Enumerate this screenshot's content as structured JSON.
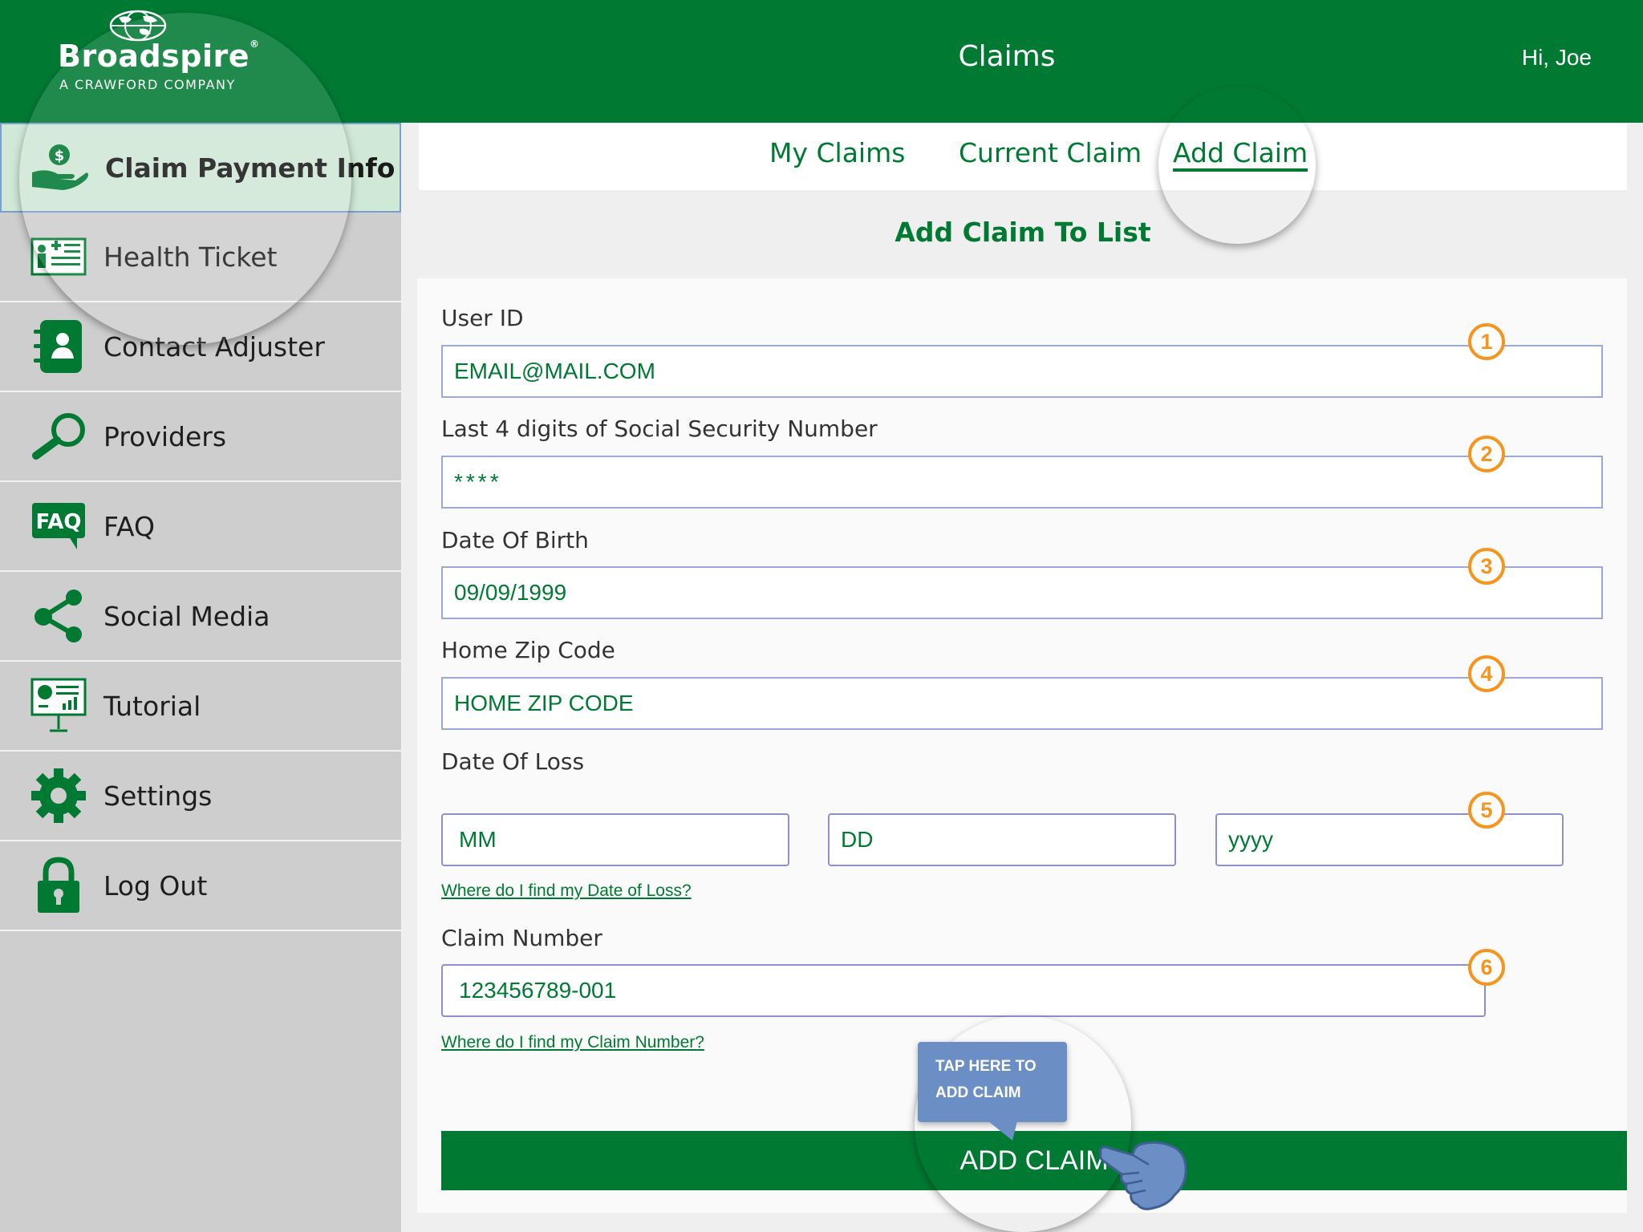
{
  "header": {
    "brand": "Broadspire",
    "brand_mark": "®",
    "brand_sub": "A CRAWFORD COMPANY",
    "title": "Claims",
    "greeting": "Hi, Joe"
  },
  "sidebar": {
    "items": [
      {
        "label": "Claim Payment Info",
        "icon": "hand-money-icon",
        "active": true
      },
      {
        "label": "Health Ticket",
        "icon": "health-card-icon"
      },
      {
        "label": "Contact Adjuster",
        "icon": "address-book-icon"
      },
      {
        "label": "Providers",
        "icon": "magnifier-icon"
      },
      {
        "label": "FAQ",
        "icon": "faq-bubble-icon"
      },
      {
        "label": "Social Media",
        "icon": "share-icon"
      },
      {
        "label": "Tutorial",
        "icon": "presentation-board-icon"
      },
      {
        "label": "Settings",
        "icon": "gear-icon"
      },
      {
        "label": "Log Out",
        "icon": "padlock-icon"
      }
    ],
    "faq_icon_text": "FAQ"
  },
  "tabs": [
    {
      "label": "My Claims"
    },
    {
      "label": "Current Claim"
    },
    {
      "label": "Add Claim",
      "active": true
    }
  ],
  "form": {
    "title": "Add Claim To List",
    "user_id": {
      "label": "User ID",
      "value": "EMAIL@MAIL.COM",
      "marker": "1"
    },
    "ssn": {
      "label": "Last 4 digits of Social Security Number",
      "value": "****",
      "marker": "2"
    },
    "dob": {
      "label": "Date Of Birth",
      "value": "09/09/1999",
      "marker": "3"
    },
    "zip": {
      "label": "Home Zip Code",
      "value": "HOME ZIP CODE",
      "marker": "4"
    },
    "date_of_loss": {
      "label": "Date Of Loss",
      "month": "MM",
      "day": "DD",
      "year": "yyyy",
      "marker": "5",
      "help": "Where do I find my Date of Loss?"
    },
    "claim_number": {
      "label": "Claim Number",
      "value": "123456789-001",
      "marker": "6",
      "help": "Where do I find my Claim Number?"
    },
    "submit_label": "ADD CLAIM"
  },
  "tooltip": {
    "line1": "TAP HERE TO",
    "line2": "ADD CLAIM"
  },
  "colors": {
    "brand_green": "#007a33",
    "marker_orange": "#f7941d",
    "tooltip_blue": "#6b8fc4"
  }
}
